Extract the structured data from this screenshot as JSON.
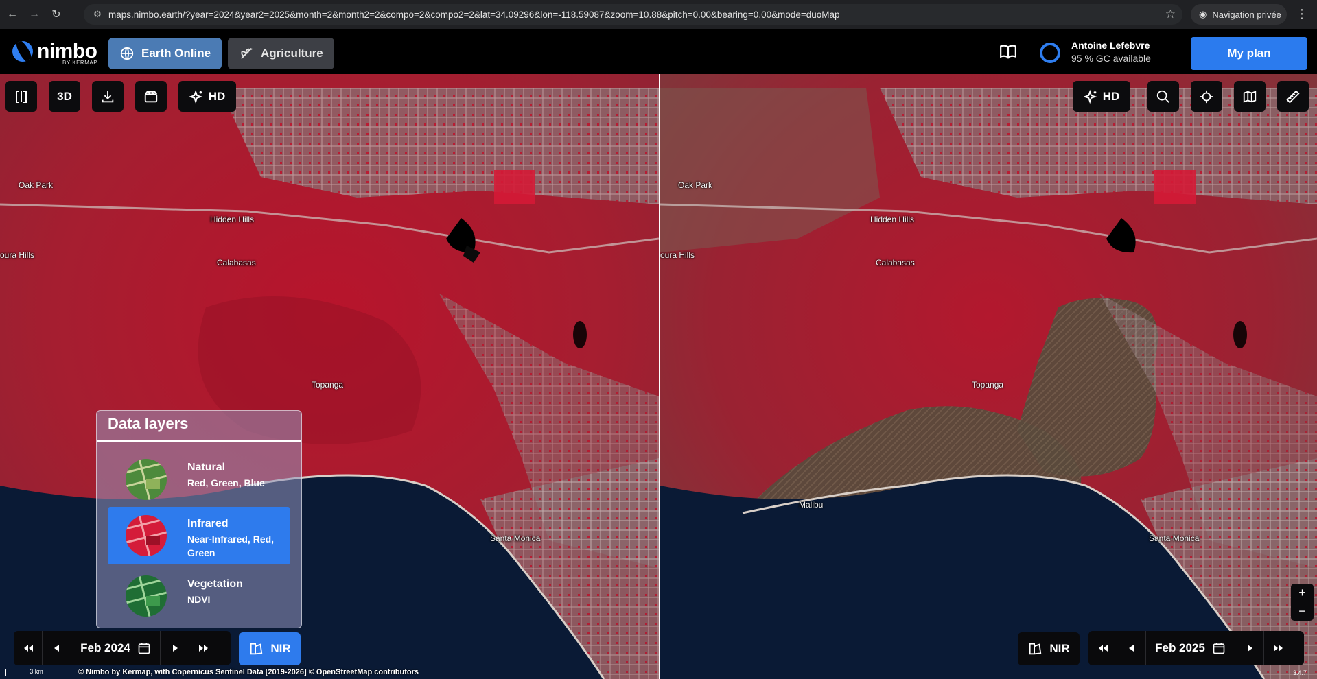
{
  "browser": {
    "url": "maps.nimbo.earth/?year=2024&year2=2025&month=2&month2=2&compo=2&compo2=2&lat=34.09296&lon=-118.59087&zoom=10.88&pitch=0.00&bearing=0.00&mode=duoMap",
    "private_label": "Navigation privée"
  },
  "header": {
    "logo_text": "nimbo",
    "logo_sub": "BY KERMAP",
    "tabs": [
      {
        "label": "Earth Online",
        "active": true
      },
      {
        "label": "Agriculture",
        "active": false
      }
    ],
    "user_name": "Antoine Lefebvre",
    "user_credits": "95 % GC available",
    "plan_label": "My plan"
  },
  "toolbar_left": {
    "btn_3d": "3D",
    "btn_hd": "HD"
  },
  "toolbar_right": {
    "btn_hd": "HD"
  },
  "map_labels": {
    "left": [
      {
        "text": "Oak Park"
      },
      {
        "text": "Hidden Hills"
      },
      {
        "text": "oura Hills"
      },
      {
        "text": "Calabasas"
      },
      {
        "text": "Topanga"
      },
      {
        "text": "Santa Monica"
      }
    ],
    "right": [
      {
        "text": "Oak Park"
      },
      {
        "text": "Hidden Hills"
      },
      {
        "text": "oura Hills"
      },
      {
        "text": "Calabasas"
      },
      {
        "text": "Topanga"
      },
      {
        "text": "Malibu"
      },
      {
        "text": "Santa Monica"
      }
    ]
  },
  "layers_panel": {
    "title": "Data layers",
    "options": [
      {
        "name": "Natural",
        "desc": "Red, Green, Blue",
        "active": false
      },
      {
        "name": "Infrared",
        "desc": "Near-Infrared, Red, Green",
        "active": true
      },
      {
        "name": "Vegetation",
        "desc": "NDVI",
        "active": false
      }
    ]
  },
  "timeline_left": {
    "date": "Feb 2024",
    "layer_label": "NIR"
  },
  "timeline_right": {
    "date": "Feb 2025",
    "layer_label": "NIR"
  },
  "zoom": {
    "plus": "+",
    "minus": "−"
  },
  "scale": "3 km",
  "attribution": "© Nimbo by Kermap, with Copernicus Sentinel Data [2019-2026] © OpenStreetMap contributors",
  "version": "3.4.7",
  "colors": {
    "accent": "#2b7bee",
    "vegetation_red": "#c41a33",
    "burn_scar": "#5a4a3c",
    "ocean": "#0a1a35"
  }
}
